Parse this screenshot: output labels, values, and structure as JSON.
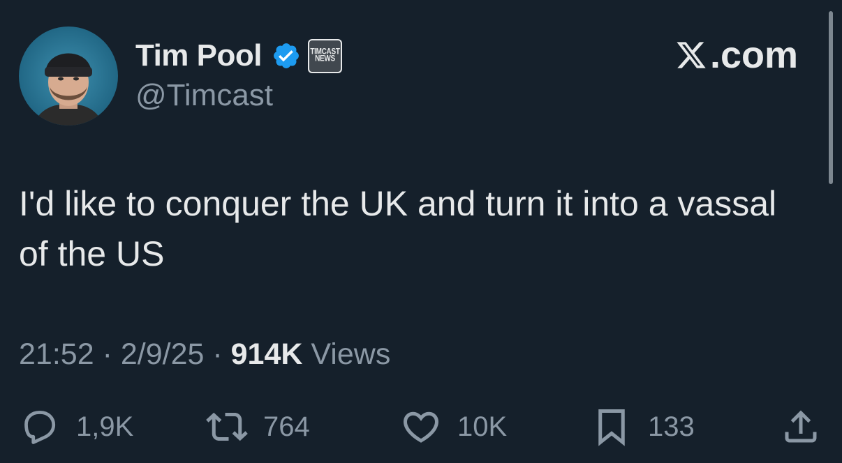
{
  "author": {
    "display_name": "Tim Pool",
    "handle": "@Timcast",
    "verified_icon": "verified-badge-icon",
    "affiliate_badge": {
      "line1": "TIMCAST",
      "line2": "NEWS"
    }
  },
  "source": {
    "site_rest": ".com"
  },
  "tweet": {
    "text": "I'd like to conquer the UK and turn it into a vassal of the US"
  },
  "meta": {
    "time": "21:52",
    "date": "2/9/25",
    "separator": "·",
    "views_count": "914K",
    "views_label": "Views"
  },
  "actions": {
    "replies": "1,9K",
    "reposts": "764",
    "likes": "10K",
    "bookmarks": "133"
  },
  "colors": {
    "background": "#15202b",
    "text_primary": "#e7e9ea",
    "text_secondary": "#8b98a5",
    "verified_blue": "#1d9bf0"
  }
}
